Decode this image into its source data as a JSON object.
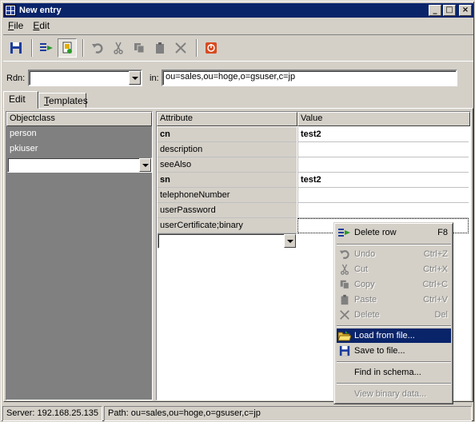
{
  "window": {
    "title": "New entry"
  },
  "menu": [
    {
      "key": "F",
      "rest": "ile"
    },
    {
      "key": "E",
      "rest": "dit"
    }
  ],
  "toolbar": {
    "icons": [
      "save-icon",
      "add-row-icon",
      "load-file-icon",
      "undo-icon",
      "cut-icon",
      "copy-icon",
      "paste-icon",
      "delete-icon",
      "exit-icon"
    ]
  },
  "rdn": {
    "label": "Rdn:",
    "value": "",
    "in_label": "in:",
    "in_value": "ou=sales,ou=hoge,o=gsuser,c=jp"
  },
  "tabs": [
    {
      "label": "Edit",
      "active": true
    },
    {
      "label": "Templates",
      "active": false
    }
  ],
  "objectclass": {
    "header": "Objectclass",
    "items": [
      "person",
      "pkiuser"
    ]
  },
  "attributes": {
    "header_attr": "Attribute",
    "header_value": "Value",
    "rows": [
      {
        "name": "cn",
        "value": "test2",
        "required": true
      },
      {
        "name": "description",
        "value": "",
        "required": false
      },
      {
        "name": "seeAlso",
        "value": "",
        "required": false
      },
      {
        "name": "sn",
        "value": "test2",
        "required": true
      },
      {
        "name": "telephoneNumber",
        "value": "",
        "required": false
      },
      {
        "name": "userPassword",
        "value": "",
        "required": false
      },
      {
        "name": "userCertificate;binary",
        "value": "",
        "required": false
      }
    ]
  },
  "context_menu": {
    "delete_row": {
      "label": "Delete row",
      "shortcut": "F8"
    },
    "undo": {
      "label": "Undo",
      "shortcut": "Ctrl+Z"
    },
    "cut": {
      "label": "Cut",
      "shortcut": "Ctrl+X"
    },
    "copy": {
      "label": "Copy",
      "shortcut": "Ctrl+C"
    },
    "paste": {
      "label": "Paste",
      "shortcut": "Ctrl+V"
    },
    "delete": {
      "label": "Delete",
      "shortcut": "Del"
    },
    "load_from_file": {
      "label": "Load from file..."
    },
    "save_to_file": {
      "label": "Save to file..."
    },
    "find_in_schema": {
      "label": "Find in schema..."
    },
    "view_binary": {
      "label": "View binary data..."
    }
  },
  "status": {
    "server": "Server: 192.168.25.135",
    "path": "Path: ou=sales,ou=hoge,o=gsuser,c=jp"
  }
}
